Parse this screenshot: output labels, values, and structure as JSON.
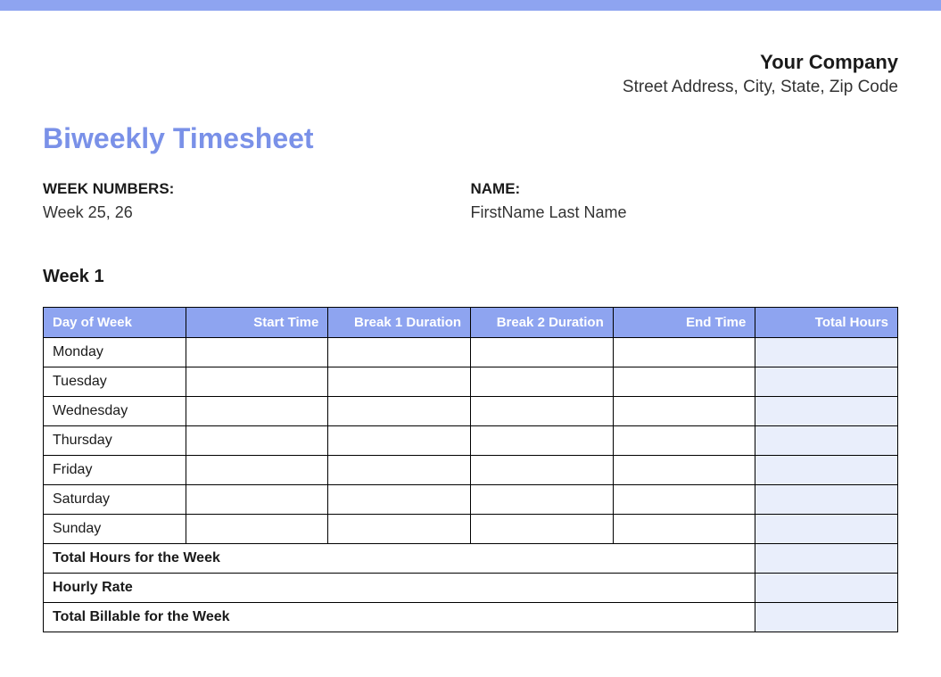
{
  "company": {
    "name": "Your Company",
    "address": "Street Address, City, State, Zip Code"
  },
  "document": {
    "title": "Biweekly Timesheet"
  },
  "info": {
    "week_numbers_label": "WEEK NUMBERS:",
    "week_numbers_value": "Week 25, 26",
    "name_label": "NAME:",
    "name_value": "FirstName Last Name"
  },
  "week1": {
    "title": "Week 1",
    "headers": {
      "day": "Day of Week",
      "start": "Start Time",
      "break1": "Break 1 Duration",
      "break2": "Break 2 Duration",
      "end": "End Time",
      "total": "Total Hours"
    },
    "days": {
      "mon": "Monday",
      "tue": "Tuesday",
      "wed": "Wednesday",
      "thu": "Thursday",
      "fri": "Friday",
      "sat": "Saturday",
      "sun": "Sunday"
    },
    "summary": {
      "total_hours": "Total Hours for the Week",
      "hourly_rate": "Hourly Rate",
      "total_billable": "Total Billable for the Week"
    }
  }
}
